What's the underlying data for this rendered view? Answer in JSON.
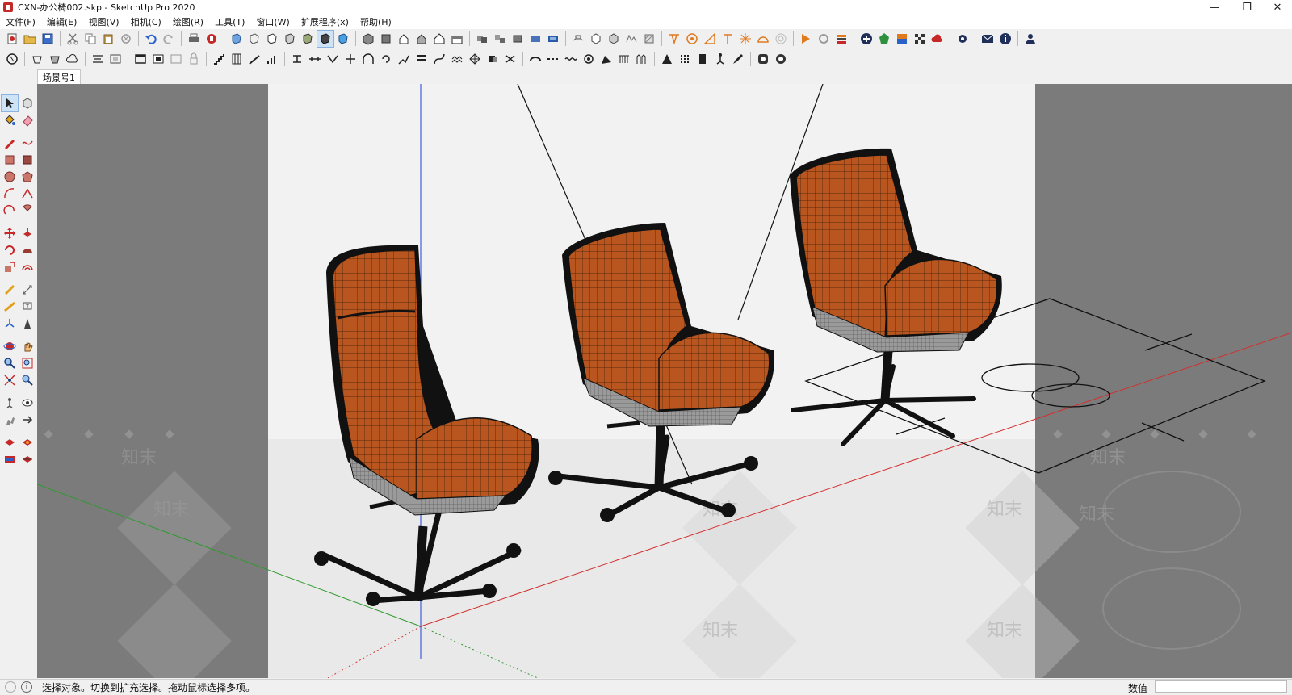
{
  "window": {
    "title": "CXN-办公椅002.skp - SketchUp Pro 2020",
    "controls": [
      "minimize",
      "restore",
      "close"
    ]
  },
  "menu": [
    "文件(F)",
    "编辑(E)",
    "视图(V)",
    "相机(C)",
    "绘图(R)",
    "工具(T)",
    "窗口(W)",
    "扩展程序(x)",
    "帮助(H)"
  ],
  "scene_tabs": [
    "场景号1"
  ],
  "viewport": {
    "watermark_text": "知末",
    "colors": {
      "background": "#7b7b7b",
      "sky": "#f2f2f2",
      "ground": "#ebebeb",
      "chair": "#b9561f",
      "axis_red": "#d32f2f",
      "axis_green": "#2e9a2e",
      "axis_blue": "#1f3fd6"
    }
  },
  "status": {
    "message": "选择对象。切换到扩充选择。拖动鼠标选择多项。",
    "measurement_label": "数值",
    "measurement_value": ""
  }
}
